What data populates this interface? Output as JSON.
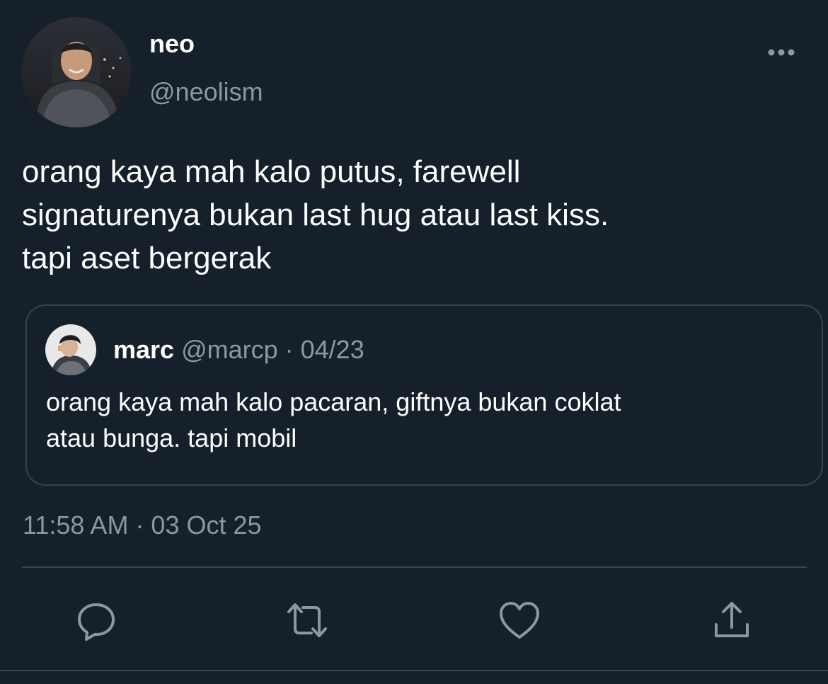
{
  "tweet": {
    "author": {
      "display_name": "neo",
      "handle": "@neolism"
    },
    "text": "orang kaya mah kalo putus, farewell\nsignaturenya bukan last hug atau last kiss.\ntapi aset bergerak",
    "timestamp": "11:58 AM · 03 Oct 25"
  },
  "quoted_tweet": {
    "display_name": "marc",
    "meta": " @marcp · 04/23",
    "text": "orang kaya mah kalo pacaran, giftnya bukan coklat\natau bunga. tapi mobil"
  },
  "actions": {
    "reply_icon": "reply-icon",
    "retweet_icon": "retweet-icon",
    "like_icon": "heart-icon",
    "share_icon": "share-icon",
    "more_icon": "more-horizontal-icon"
  },
  "colors": {
    "background": "#15202b",
    "text_primary": "#ffffff",
    "text_secondary": "#8899a6",
    "border": "#38444d"
  }
}
